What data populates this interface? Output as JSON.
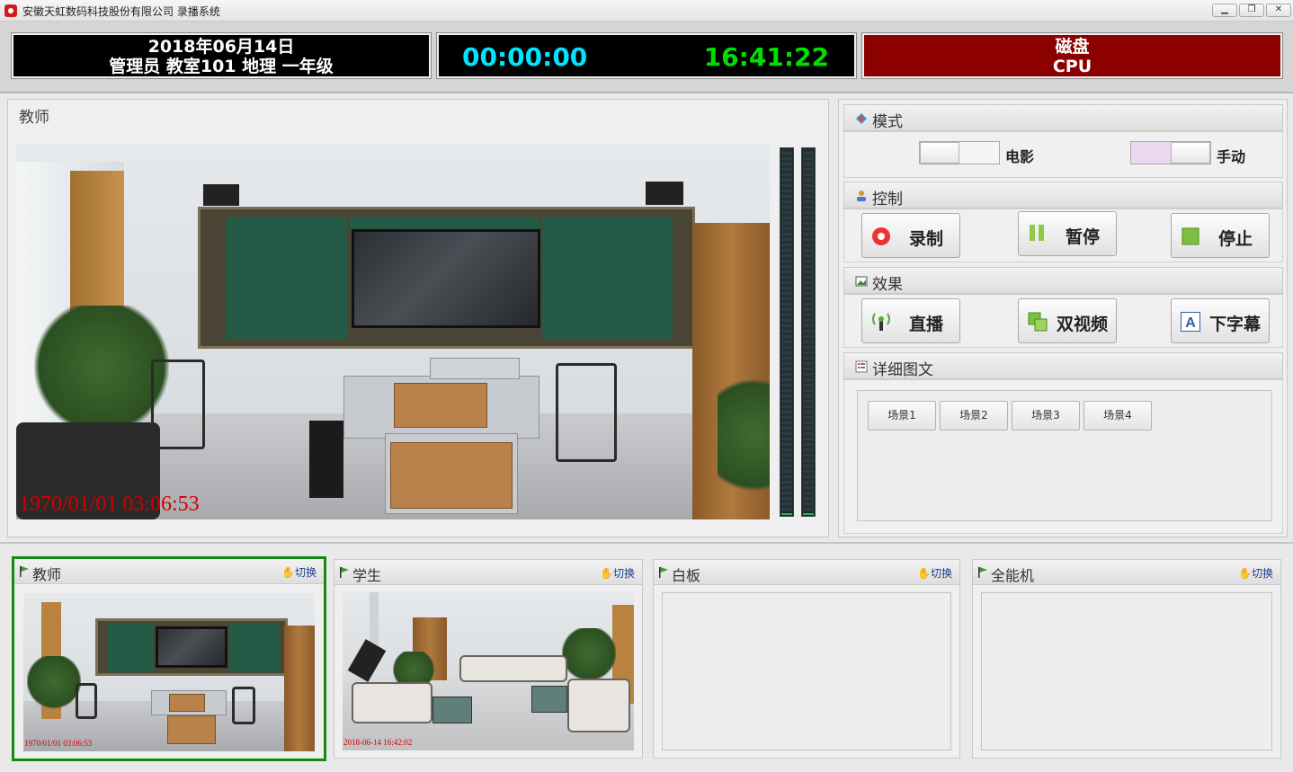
{
  "window": {
    "title": "安徽天虹数码科技股份有限公司 录播系统",
    "minimize_icon": "minimize-icon",
    "restore_icon": "restore-icon",
    "close_icon": "close-icon"
  },
  "status": {
    "date": "2018年06月14日",
    "info": "管理员 教室101 地理 一年级",
    "record_timer": "00:00:00",
    "clock": "16:41:22",
    "disk_label": "磁盘",
    "cpu_label": "CPU",
    "colors": {
      "timer": "#00e5ff",
      "clock": "#00e000",
      "alert_bg": "#8c0000"
    }
  },
  "main_view": {
    "title": "教师",
    "timestamp": "1970/01/01 03:06:53"
  },
  "mode": {
    "title": "模式",
    "movie_label": "电影",
    "manual_label": "手动"
  },
  "control": {
    "title": "控制",
    "record_label": "录制",
    "pause_label": "暂停",
    "stop_label": "停止"
  },
  "effects": {
    "title": "效果",
    "live_label": "直播",
    "dual_video_label": "双视频",
    "subtitle_label": "下字幕"
  },
  "details": {
    "title": "详细图文",
    "scenes": [
      "场景1",
      "场景2",
      "场景3",
      "场景4"
    ]
  },
  "thumbnails": [
    {
      "title": "教师",
      "switch_label": "切换",
      "timestamp": "1970/01/01 03:06:53"
    },
    {
      "title": "学生",
      "switch_label": "切换",
      "timestamp": "2018-06-14 16:42:02"
    },
    {
      "title": "白板",
      "switch_label": "切换"
    },
    {
      "title": "全能机",
      "switch_label": "切换"
    }
  ]
}
